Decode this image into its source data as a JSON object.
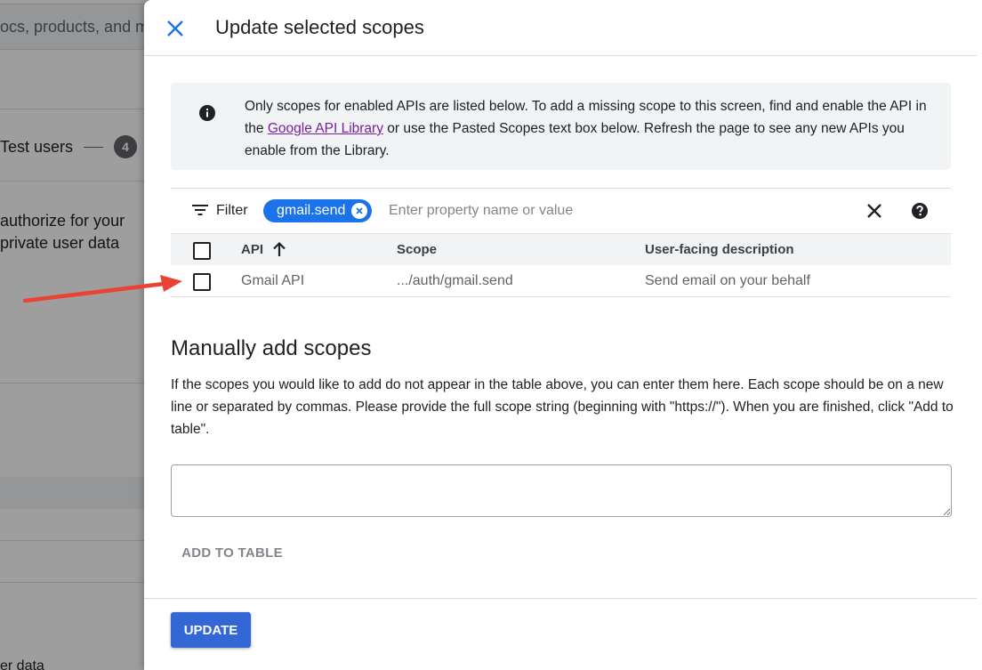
{
  "background": {
    "search_text": "ocs, products, and m",
    "step_label": "Test users",
    "step_number": "4",
    "text_line1": "authorize for your",
    "text_line2": "private user data",
    "bottom_text": "er data"
  },
  "panel": {
    "title": "Update selected scopes",
    "info": {
      "text_before_link": "Only scopes for enabled APIs are listed below. To add a missing scope to this screen, find and enable the API in the ",
      "link": "Google API Library",
      "text_after_link": " or use the Pasted Scopes text box below. Refresh the page to see any new APIs you enable from the Library."
    },
    "filter": {
      "label": "Filter",
      "chip": "gmail.send",
      "placeholder": "Enter property name or value"
    },
    "table": {
      "headers": {
        "api": "API",
        "scope": "Scope",
        "description": "User-facing description"
      },
      "rows": [
        {
          "api": "Gmail API",
          "scope": ".../auth/gmail.send",
          "description": "Send email on your behalf",
          "checked": false
        }
      ]
    },
    "manual": {
      "title": "Manually add scopes",
      "description": "If the scopes you would like to add do not appear in the table above, you can enter them here. Each scope should be on a new line or separated by commas. Please provide the full scope string (beginning with \"https://\"). When you are finished, click \"Add to table\".",
      "textarea_value": "",
      "add_button": "ADD TO TABLE"
    },
    "update_button": "UPDATE"
  },
  "colors": {
    "primary": "#1a73e8",
    "update_button": "#3367d6",
    "link": "#7b1fa2",
    "arrow": "#ea4335"
  }
}
